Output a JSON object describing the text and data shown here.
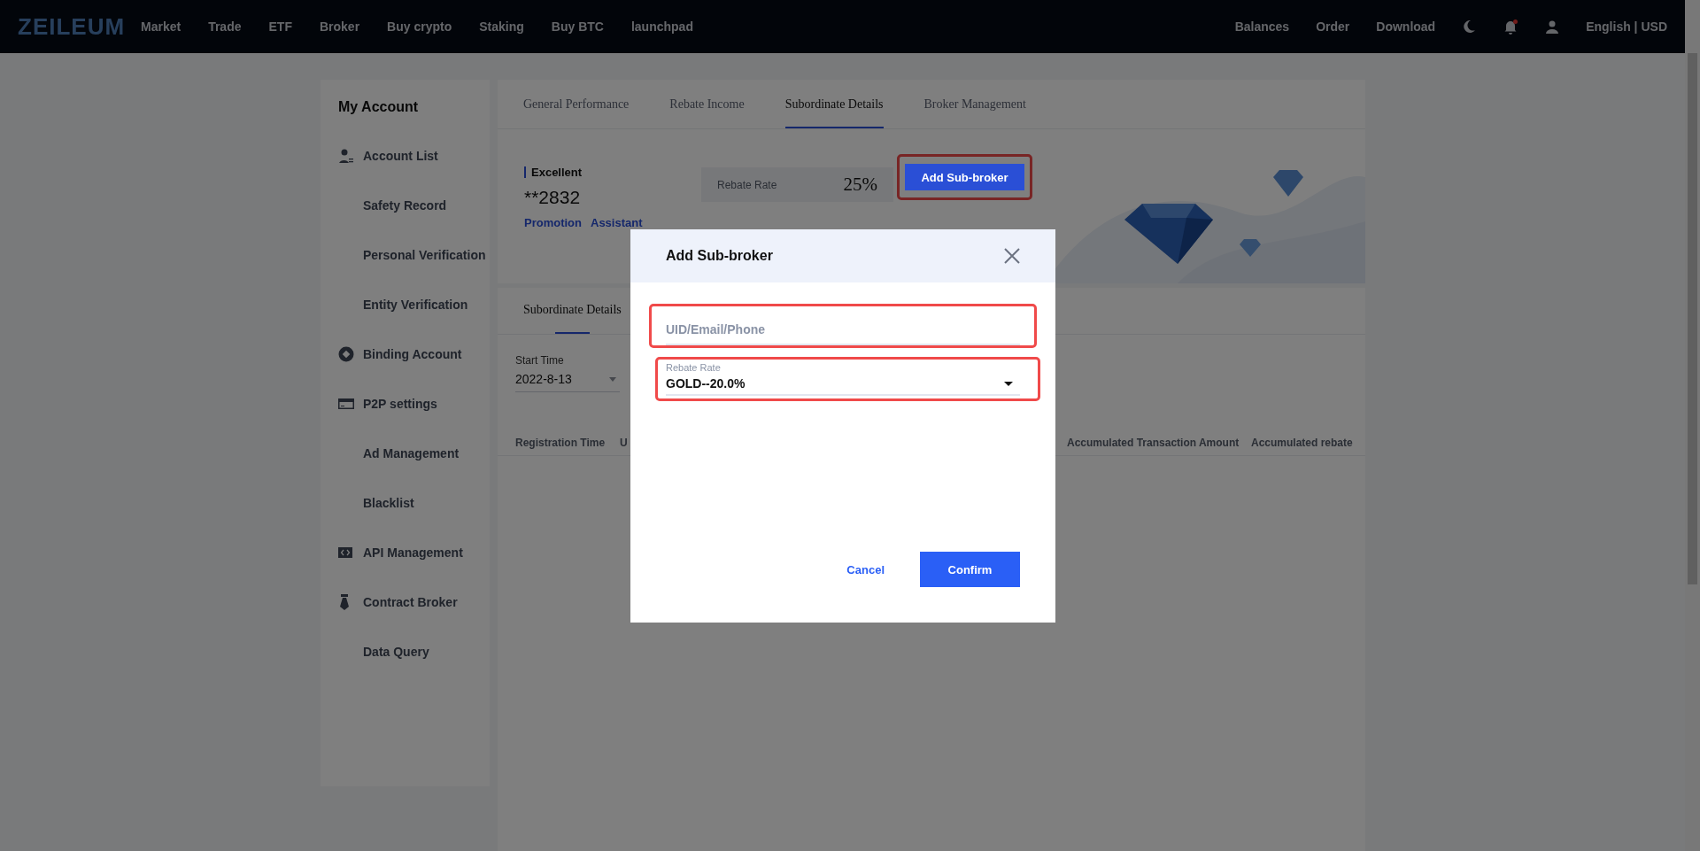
{
  "header": {
    "logo": "ZEILEUM",
    "nav": [
      "Market",
      "Trade",
      "ETF",
      "Broker",
      "Buy crypto",
      "Staking",
      "Buy BTC",
      "launchpad"
    ],
    "right_links": [
      "Balances",
      "Order",
      "Download"
    ],
    "notifications_unread": true,
    "locale": "English | USD"
  },
  "sidebar": {
    "title": "My Account",
    "sections": [
      {
        "label": "Account List",
        "children": [
          {
            "label": "Safety Record"
          },
          {
            "label": "Personal Verification"
          },
          {
            "label": "Entity Verification"
          }
        ]
      },
      {
        "label": "Binding Account"
      },
      {
        "label": "P2P settings",
        "children": [
          {
            "label": "Ad Management"
          },
          {
            "label": "Blacklist"
          }
        ]
      },
      {
        "label": "API Management"
      },
      {
        "label": "Contract Broker",
        "children": [
          {
            "label": "Data Query"
          }
        ]
      }
    ]
  },
  "tabs": [
    {
      "label": "General Performance",
      "selected": false
    },
    {
      "label": "Rebate Income",
      "selected": false
    },
    {
      "label": "Subordinate Details",
      "selected": true
    },
    {
      "label": "Broker Management",
      "selected": false
    }
  ],
  "profile": {
    "tier": "Excellent",
    "account": "**2832",
    "links": [
      "Promotion",
      "Assistant"
    ]
  },
  "rebate": {
    "label": "Rebate Rate",
    "value": "25%"
  },
  "add_button": {
    "label": "Add Sub-broker",
    "highlighted": true
  },
  "sub_tabs": [
    {
      "label": "Subordinate Details",
      "selected": true
    }
  ],
  "filter": {
    "label": "Start Time",
    "value": "2022-8-13"
  },
  "table": {
    "columns": [
      "Registration Time",
      "U",
      "Accumulated Transaction Amount",
      "Accumulated rebate"
    ]
  },
  "modal": {
    "title": "Add Sub-broker",
    "uid_field": {
      "placeholder": "UID/Email/Phone",
      "highlighted": true
    },
    "rate_field": {
      "label": "Rebate Rate",
      "value": "GOLD--20.0%",
      "highlighted": true
    },
    "buttons": [
      {
        "label": "Cancel",
        "kind": "text"
      },
      {
        "label": "Confirm",
        "kind": "primary"
      }
    ]
  }
}
